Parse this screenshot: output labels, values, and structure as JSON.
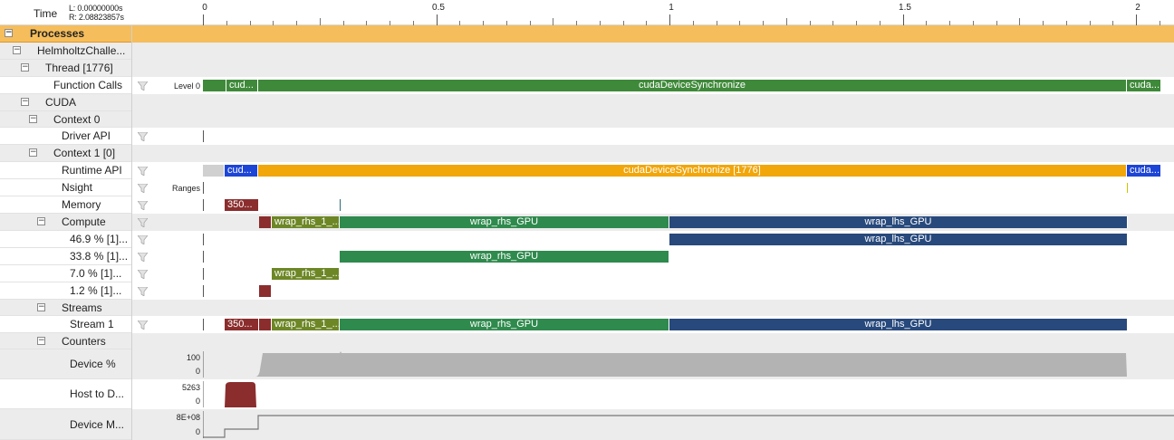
{
  "header": {
    "time_label": "Time",
    "left_cursor": "L: 0.00000000s",
    "right_cursor": "R: 2.08823857s",
    "ticks": [
      {
        "value": 0,
        "label": "0"
      },
      {
        "value": 0.5,
        "label": "0.5"
      },
      {
        "value": 1,
        "label": "1"
      },
      {
        "value": 1.5,
        "label": "1.5"
      },
      {
        "value": 2,
        "label": "2"
      }
    ]
  },
  "tree": {
    "processes": "Processes",
    "process": "HelmholtzChalle...",
    "thread": "Thread [1776]",
    "function_calls": "Function Calls",
    "cuda": "CUDA",
    "context0": "Context 0",
    "driver_api": "Driver API",
    "context1": "Context 1 [0]",
    "runtime_api": "Runtime API",
    "nsight": "Nsight",
    "memory": "Memory",
    "compute": "Compute",
    "c1": "46.9 % [1]...",
    "c2": "33.8 % [1]...",
    "c3": "7.0 % [1]...",
    "c4": "1.2 % [1]...",
    "streams": "Streams",
    "stream1": "Stream 1",
    "counters": "Counters",
    "device_pct": "Device %",
    "host_to_device": "Host to D...",
    "device_mem": "Device M..."
  },
  "meta": {
    "level": "Level 0",
    "ranges": "Ranges",
    "device_pct_max": "100",
    "device_pct_min": "0",
    "htod_max": "5263",
    "htod_min": "0",
    "devmem_max": "8E+08",
    "devmem_min": "0"
  },
  "events": {
    "fc_a": "cud...",
    "fc_main": "cudaDeviceSynchronize",
    "fc_b": "cuda...",
    "rt_a": "cud...",
    "rt_main": "cudaDeviceSynchronize [1776]",
    "rt_b": "cuda...",
    "mem_a": "350...",
    "rhs1": "wrap_rhs_1_...",
    "rhs": "wrap_rhs_GPU",
    "lhs": "wrap_lhs_GPU",
    "lhs_c1": "wrap_lhs_GPU",
    "rhs_c2": "wrap_rhs_GPU",
    "rhs1_c3": "wrap_rhs_1_...",
    "st_mem": "350...",
    "st_rhs1": "wrap_rhs_1_...",
    "st_rhs": "wrap_rhs_GPU",
    "st_lhs": "wrap_lhs_GPU"
  },
  "colors": {
    "selection": "#f5bd5c",
    "function_call": "#3f8a3a",
    "runtime_api": "#f1a60a",
    "runtime_short": "#1d45d6",
    "lhs_kernel": "#27497c",
    "rhs_kernel": "#2f8a4d",
    "rhs1_kernel": "#6d8726",
    "memcpy": "#8b2d2d"
  }
}
